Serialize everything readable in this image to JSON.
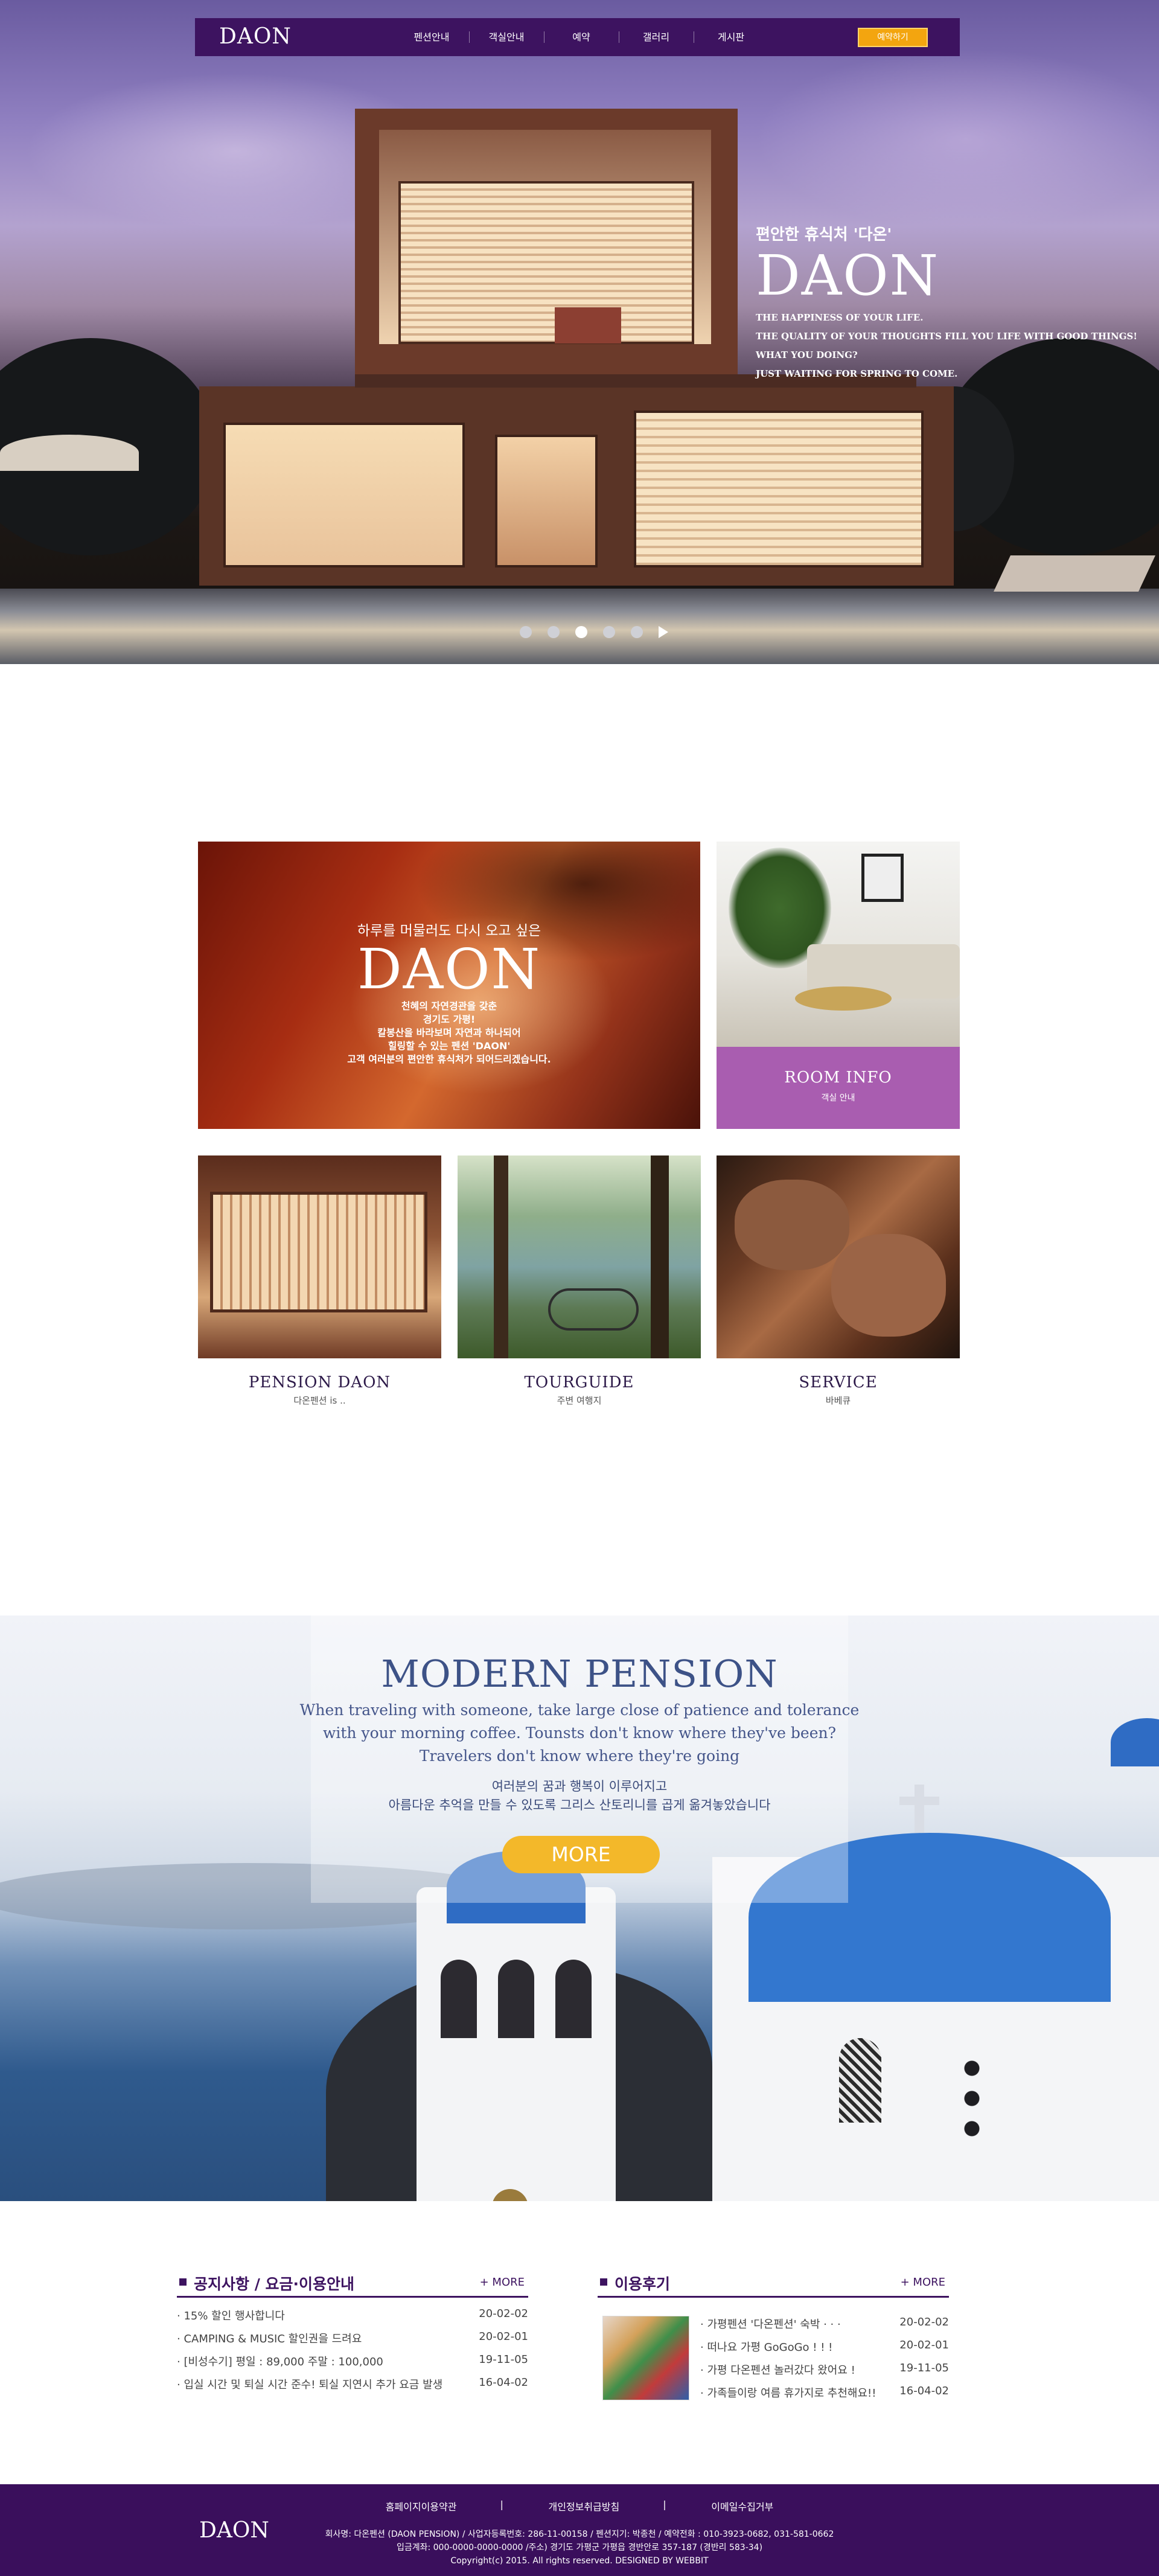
{
  "nav": {
    "logo": "DAON",
    "menu": [
      "펜션안내",
      "객실안내",
      "예약",
      "갤러리",
      "게시판"
    ],
    "reserve_button": "예약하기"
  },
  "hero": {
    "kicker": "편안한 휴식처 '다온'",
    "title": "DAON",
    "lines": [
      "THE HAPPINESS OF YOUR LIFE.",
      "THE QUALITY OF  YOUR THOUGHTS FILL YOU LIFE WITH GOOD THINGS!",
      "WHAT YOU DOING?",
      "JUST WAITING FOR SPRING TO COME."
    ],
    "slider": {
      "count": 5,
      "active_index": 2,
      "play_icon": "play-icon"
    }
  },
  "promo": {
    "line1": "하루를 머물러도 다시 오고 싶은",
    "title": "DAON",
    "body": [
      "천혜의 자연경관을 갖춘",
      "경기도 가평!",
      "칼봉산을 바라보며 자연과 하나되어",
      "힐링할 수 있는 펜션 'DAON'",
      "고객 여러분의 편안한 휴식처가 되어드리겠습니다."
    ]
  },
  "room_info": {
    "title": "ROOM INFO",
    "sub": "객실 안내",
    "band_color": "#a95db0"
  },
  "thumbs": [
    {
      "title": "PENSION DAON",
      "sub": "다온펜션 is .."
    },
    {
      "title": "TOURGUIDE",
      "sub": "주변 여행지"
    },
    {
      "title": "SERVICE",
      "sub": "바베큐"
    }
  ],
  "modern": {
    "title": "MODERN PENSION",
    "eng": [
      "When traveling with someone, take large close of  patience and tolerance",
      "with your morning coffee. Tounsts don't know where they've been?",
      "Travelers don't know where they're going"
    ],
    "kor": [
      "여러분의 꿈과 행복이 이루어지고",
      "아름다운 추억을 만들 수 있도록 그리스 산토리니를 곱게 옮겨놓았습니다"
    ],
    "more_button": "MORE"
  },
  "notice": {
    "title": "공지사항 / 요금·이용안내",
    "more": "+ MORE",
    "items": [
      {
        "text": "· 15% 할인 행사합니다",
        "date": "20-02-02"
      },
      {
        "text": "· CAMPING & MUSIC 할인권을 드려요",
        "date": "20-02-01"
      },
      {
        "text": "· [비성수기] 평일 : 89,000 주말 : 100,000",
        "date": "19-11-05"
      },
      {
        "text": "· 입실 시간 및 퇴실 시간 준수! 퇴실 지연시 추가 요금 발생",
        "date": "16-04-02"
      }
    ]
  },
  "review": {
    "title": "이용후기",
    "more": "+ MORE",
    "items": [
      {
        "text": "· 가평펜션 '다온펜션' 숙박 · · ·",
        "date": "20-02-02"
      },
      {
        "text": "· 떠나요 가평 GoGoGo ! ! !",
        "date": "20-02-01"
      },
      {
        "text": "· 가평 다온펜션 놀러갔다 왔어요 !",
        "date": "19-11-05"
      },
      {
        "text": "· 가족들이랑 여름 휴가지로 추천해요!!",
        "date": "16-04-02"
      }
    ]
  },
  "footer": {
    "links": [
      "홈페이지이용약관",
      "개인정보취급방침",
      "이메일수집거부"
    ],
    "logo": "DAON",
    "info": [
      "회사명: 다온펜션 (DAON PENSION) / 사업자등록번호: 286-11-00158 / 펜션지기: 박종천 / 예약전화 : 010-3923-0682, 031-581-0662",
      "입금계좌: 000-0000-0000-0000 /주소) 경기도 가평군 가평읍 경반안로 357-187 (경반리 583-34)",
      "Copyright(c) 2015. All rights reserved. DESIGNED BY WEBBIT"
    ]
  },
  "colors": {
    "brand_purple": "#3d1360",
    "accent_yellow": "#f3b82a",
    "room_band": "#a95db0",
    "footer_bg": "#3a0f5c"
  }
}
